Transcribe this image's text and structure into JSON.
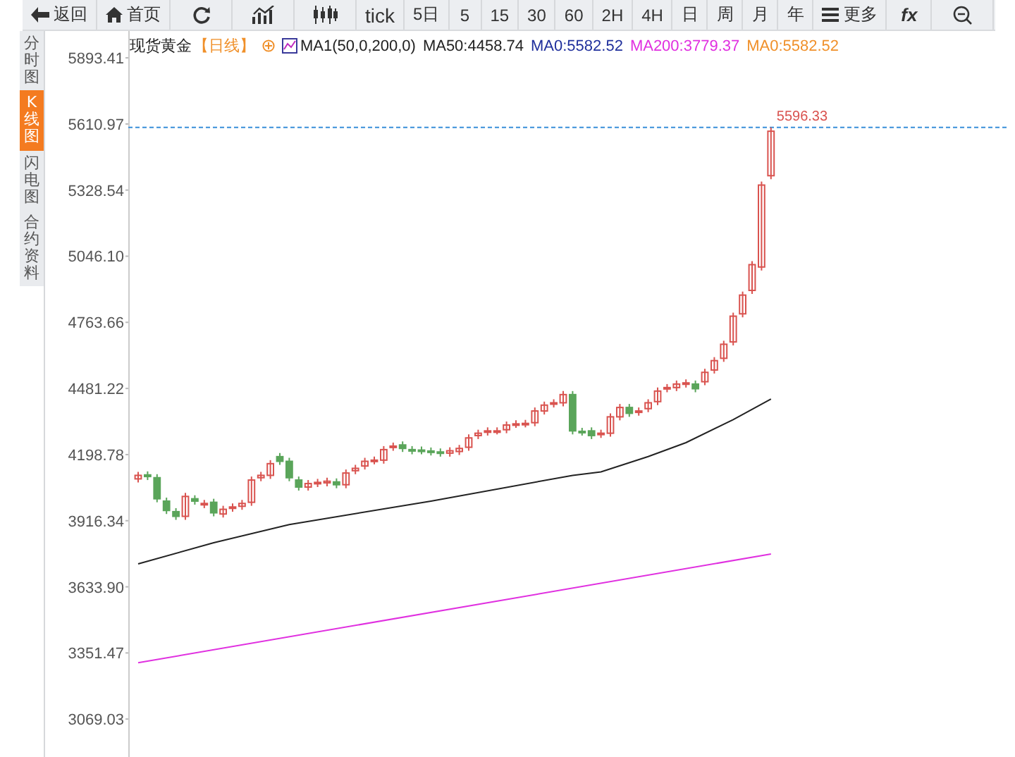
{
  "toolbar": [
    {
      "kind": "back",
      "label": "返回"
    },
    {
      "kind": "home",
      "label": "首页"
    },
    {
      "kind": "refresh"
    },
    {
      "kind": "indicator"
    },
    {
      "kind": "candles"
    },
    {
      "kind": "period",
      "label": "tick"
    },
    {
      "kind": "period",
      "label": "5日"
    },
    {
      "kind": "period",
      "label": "5"
    },
    {
      "kind": "period",
      "label": "15"
    },
    {
      "kind": "period",
      "label": "30"
    },
    {
      "kind": "period",
      "label": "60"
    },
    {
      "kind": "period",
      "label": "2H"
    },
    {
      "kind": "period",
      "label": "4H"
    },
    {
      "kind": "period",
      "label": "日"
    },
    {
      "kind": "period",
      "label": "周"
    },
    {
      "kind": "period",
      "label": "月"
    },
    {
      "kind": "period",
      "label": "年"
    },
    {
      "kind": "more",
      "label": "更多"
    },
    {
      "kind": "formula",
      "label": "fx"
    },
    {
      "kind": "zoomout"
    }
  ],
  "side_tabs": [
    {
      "label": "分时图",
      "selected": false
    },
    {
      "label": "K线图",
      "selected": true
    },
    {
      "label": "闪电图",
      "selected": false
    },
    {
      "label": "合约资料",
      "selected": false
    }
  ],
  "legend": {
    "symbol": "现货黄金",
    "period": "【日线】",
    "indicator": "MA1(50,0,200,0)",
    "values": [
      {
        "label": "MA50:4458.74",
        "color": "#222222"
      },
      {
        "label": "MA0:5582.52",
        "color": "#1f2f9c"
      },
      {
        "label": "MA200:3779.37",
        "color": "#e030e0"
      },
      {
        "label": "MA0:5582.52",
        "color": "#f0902a"
      }
    ]
  },
  "chart_data": {
    "type": "candlestick",
    "ylim": [
      2907,
      6008
    ],
    "yticks": [
      {
        "value": 3069.03,
        "label": "3069.03"
      },
      {
        "value": 3351.47,
        "label": "3351.47"
      },
      {
        "value": 3633.9,
        "label": "3633.90"
      },
      {
        "value": 3916.34,
        "label": "3916.34"
      },
      {
        "value": 4198.78,
        "label": "4198.78"
      },
      {
        "value": 4481.22,
        "label": "4481.22"
      },
      {
        "value": 4763.66,
        "label": "4763.66"
      },
      {
        "value": 5046.1,
        "label": "5046.10"
      },
      {
        "value": 5328.54,
        "label": "5328.54"
      },
      {
        "value": 5610.97,
        "label": "5610.97"
      },
      {
        "value": 5893.41,
        "label": "5893.41"
      }
    ],
    "ohlc": [
      [
        4095,
        4125,
        4080,
        4110
      ],
      [
        4112,
        4127,
        4090,
        4105
      ],
      [
        4100,
        4115,
        3995,
        4010
      ],
      [
        4000,
        4015,
        3945,
        3960
      ],
      [
        3955,
        3970,
        3920,
        3935
      ],
      [
        3935,
        4035,
        3920,
        4020
      ],
      [
        4010,
        4025,
        3985,
        4000
      ],
      [
        3985,
        4005,
        3970,
        3990
      ],
      [
        3995,
        4010,
        3935,
        3950
      ],
      [
        3945,
        3980,
        3930,
        3965
      ],
      [
        3970,
        3990,
        3955,
        3975
      ],
      [
        3978,
        4005,
        3963,
        3990
      ],
      [
        3995,
        4105,
        3980,
        4090
      ],
      [
        4100,
        4125,
        4085,
        4110
      ],
      [
        4110,
        4175,
        4095,
        4160
      ],
      [
        4190,
        4205,
        4155,
        4170
      ],
      [
        4170,
        4185,
        4085,
        4100
      ],
      [
        4090,
        4105,
        4045,
        4060
      ],
      [
        4060,
        4090,
        4045,
        4075
      ],
      [
        4075,
        4095,
        4060,
        4080
      ],
      [
        4078,
        4100,
        4063,
        4085
      ],
      [
        4082,
        4097,
        4055,
        4070
      ],
      [
        4070,
        4135,
        4055,
        4120
      ],
      [
        4130,
        4155,
        4115,
        4140
      ],
      [
        4150,
        4185,
        4135,
        4170
      ],
      [
        4172,
        4190,
        4157,
        4175
      ],
      [
        4175,
        4235,
        4160,
        4220
      ],
      [
        4230,
        4250,
        4215,
        4235
      ],
      [
        4240,
        4255,
        4210,
        4225
      ],
      [
        4220,
        4235,
        4200,
        4215
      ],
      [
        4218,
        4233,
        4200,
        4215
      ],
      [
        4214,
        4229,
        4195,
        4210
      ],
      [
        4210,
        4225,
        4190,
        4205
      ],
      [
        4205,
        4230,
        4190,
        4215
      ],
      [
        4212,
        4240,
        4197,
        4225
      ],
      [
        4230,
        4285,
        4215,
        4270
      ],
      [
        4280,
        4305,
        4265,
        4290
      ],
      [
        4295,
        4315,
        4280,
        4300
      ],
      [
        4300,
        4315,
        4285,
        4300
      ],
      [
        4305,
        4340,
        4290,
        4325
      ],
      [
        4328,
        4345,
        4313,
        4330
      ],
      [
        4330,
        4347,
        4315,
        4332
      ],
      [
        4335,
        4400,
        4320,
        4385
      ],
      [
        4385,
        4425,
        4370,
        4410
      ],
      [
        4415,
        4435,
        4400,
        4420
      ],
      [
        4420,
        4470,
        4405,
        4455
      ],
      [
        4455,
        4470,
        4285,
        4300
      ],
      [
        4298,
        4313,
        4280,
        4295
      ],
      [
        4300,
        4315,
        4265,
        4280
      ],
      [
        4285,
        4305,
        4270,
        4290
      ],
      [
        4290,
        4375,
        4275,
        4360
      ],
      [
        4360,
        4415,
        4345,
        4400
      ],
      [
        4400,
        4415,
        4360,
        4375
      ],
      [
        4380,
        4400,
        4365,
        4385
      ],
      [
        4395,
        4435,
        4380,
        4420
      ],
      [
        4425,
        4485,
        4410,
        4470
      ],
      [
        4480,
        4500,
        4465,
        4485
      ],
      [
        4485,
        4515,
        4470,
        4500
      ],
      [
        4500,
        4520,
        4485,
        4505
      ],
      [
        4500,
        4515,
        4465,
        4480
      ],
      [
        4510,
        4565,
        4495,
        4550
      ],
      [
        4560,
        4615,
        4545,
        4600
      ],
      [
        4610,
        4685,
        4595,
        4670
      ],
      [
        4680,
        4805,
        4665,
        4790
      ],
      [
        4800,
        4895,
        4785,
        4880
      ],
      [
        4900,
        5025,
        4885,
        5010
      ],
      [
        5000,
        5365,
        4985,
        5350
      ],
      [
        5390,
        5596.33,
        5375,
        5580
      ]
    ],
    "ref_lines": [
      {
        "axis": "y",
        "value": 5596.33,
        "label": "5596.33",
        "color": "#3a8fd9"
      }
    ]
  }
}
